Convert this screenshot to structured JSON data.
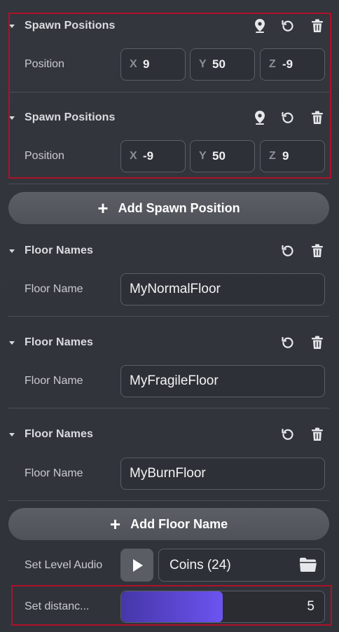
{
  "spawn_positions": [
    {
      "title": "Spawn Positions",
      "label": "Position",
      "x": "9",
      "y": "50",
      "z": "-9"
    },
    {
      "title": "Spawn Positions",
      "label": "Position",
      "x": "-9",
      "y": "50",
      "z": "9"
    }
  ],
  "axis_labels": {
    "x": "X",
    "y": "Y",
    "z": "Z"
  },
  "add_spawn_position_label": "Add Spawn Position",
  "floor_names": [
    {
      "title": "Floor Names",
      "label": "Floor Name",
      "value": "MyNormalFloor"
    },
    {
      "title": "Floor Names",
      "label": "Floor Name",
      "value": "MyFragileFloor"
    },
    {
      "title": "Floor Names",
      "label": "Floor Name",
      "value": "MyBurnFloor"
    }
  ],
  "add_floor_name_label": "Add Floor Name",
  "plus_glyph": "+",
  "level_audio": {
    "label": "Set Level Audio",
    "value": "Coins (24)"
  },
  "distance": {
    "label": "Set distanc...",
    "value": "5",
    "fill_fraction": 0.5
  },
  "colors": {
    "highlight": "#b0102a",
    "slider_start": "#4537a8",
    "slider_end": "#6c53f0",
    "button": "#55585f"
  },
  "icons": [
    "caret-down-icon",
    "location-pin-icon",
    "reset-icon",
    "trash-icon",
    "plus-icon",
    "play-icon",
    "folder-icon"
  ]
}
